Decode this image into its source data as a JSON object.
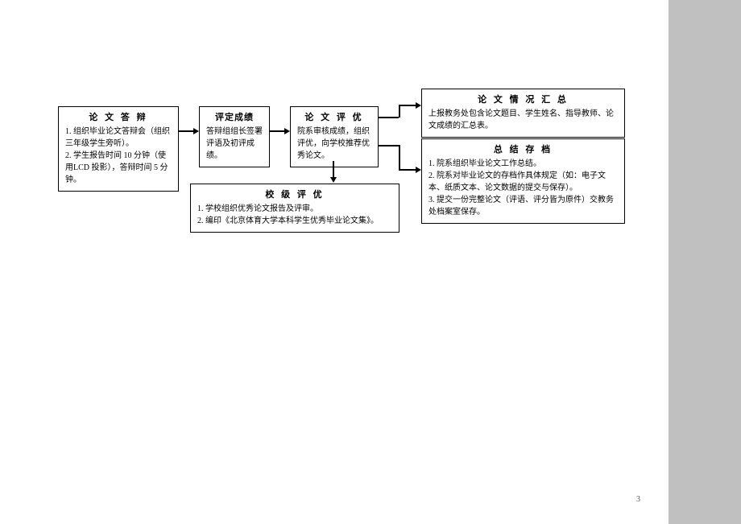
{
  "page_number": "3",
  "boxes": {
    "box1": {
      "title": "论 文 答 辩",
      "body": "1. 组织毕业论文答辩会（组织三年级学生旁听）。\n2. 学生报告时间 10 分钟（使用LCD 投影），答辩时间 5 分钟。"
    },
    "box2": {
      "title": "评定成绩",
      "body": "答辩组组长签署评语及初评成绩。"
    },
    "box3": {
      "title": "论 文 评 优",
      "body": "院系审核成绩，组织评优，向学校推荐优秀论文。"
    },
    "box4": {
      "title": "论 文 情 况 汇 总",
      "body": "上报教务处包含论文题目、学生姓名、指导教师、论文成绩的汇总表。"
    },
    "box5": {
      "title": "总 结 存 档",
      "body": "1. 院系组织毕业论文工作总结。\n2. 院系对毕业论文的存档作具体规定（如：电子文本、纸质文本、论文数据的提交与保存）。\n3. 提交一份完整论文（评语、评分皆为原件）交教务处档案室保存。"
    },
    "box6": {
      "title": "校 级 评 优",
      "body": "1. 学校组织优秀论文报告及评审。\n2. 编印《北京体育大学本科学生优秀毕业论文集》。"
    }
  }
}
